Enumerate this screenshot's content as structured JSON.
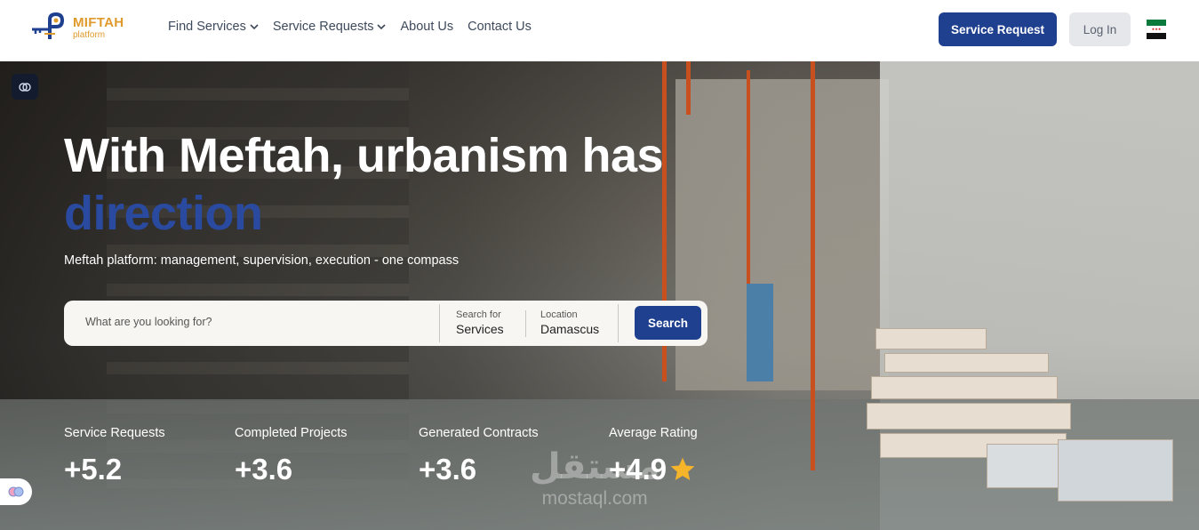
{
  "header": {
    "logo": {
      "title": "MIFTAH",
      "subtitle": "platform"
    },
    "nav": [
      {
        "label": "Find Services",
        "dropdown": true
      },
      {
        "label": "Service Requests",
        "dropdown": true
      },
      {
        "label": "About Us",
        "dropdown": false
      },
      {
        "label": "Contact Us",
        "dropdown": false
      }
    ],
    "service_request_label": "Service Request",
    "login_label": "Log In"
  },
  "hero": {
    "title_line1": "With Meftah, urbanism has",
    "title_accent": "direction",
    "subtitle": "Meftah platform: management, supervision, execution - one compass",
    "search": {
      "placeholder": "What are you looking for?",
      "search_for_label": "Search for",
      "search_for_value": "Services",
      "location_label": "Location",
      "location_value": "Damascus",
      "button_label": "Search"
    },
    "stats": [
      {
        "label": "Service Requests",
        "value": "+5.2"
      },
      {
        "label": "Completed Projects",
        "value": "+3.6"
      },
      {
        "label": "Generated Contracts",
        "value": "+3.6"
      },
      {
        "label": "Average Rating",
        "value": "+4.9"
      }
    ]
  },
  "watermark": {
    "arabic": "مستقل",
    "latin": "mostaql.com"
  },
  "colors": {
    "primary": "#1f3f8f",
    "accent": "#2a4a9f",
    "logo": "#e09a2c",
    "star": "#f5b52a"
  }
}
